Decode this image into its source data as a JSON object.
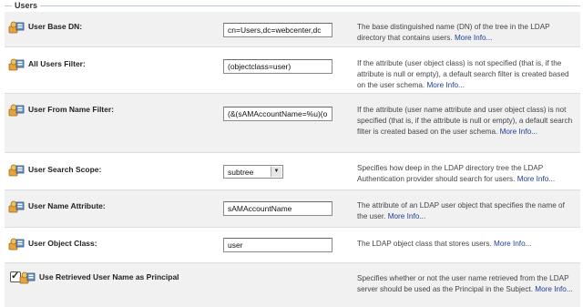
{
  "section": {
    "title": "Users"
  },
  "rows": [
    {
      "label": "User Base DN:",
      "value": "cn=Users,dc=webcenter,dc",
      "desc": "The base distinguished name (DN) of the tree in the LDAP directory that contains users.",
      "link": "More Info..."
    },
    {
      "label": "All Users Filter:",
      "value": "(objectclass=user)",
      "desc": "If the attribute (user object class) is not specified (that is, if the attribute is null or empty), a default search filter is created based on the user schema.",
      "link": "More Info..."
    },
    {
      "label": "User From Name Filter:",
      "value": "(&(sAMAccountName=%u)(o",
      "desc": "If the attribute (user name attribute and user object class) is not specified (that is, if the attribute is null or empty), a default search filter is created based on the user schema.",
      "link": "More Info..."
    },
    {
      "label": "User Search Scope:",
      "value": "subtree",
      "desc": "Specifies how deep in the LDAP directory tree the LDAP Authentication provider should search for users.",
      "link": "More Info..."
    },
    {
      "label": "User Name Attribute:",
      "value": "sAMAccountName",
      "desc": "The attribute of an LDAP user object that specifies the name of the user.",
      "link": "More Info..."
    },
    {
      "label": "User Object Class:",
      "value": "user",
      "desc": "The LDAP object class that stores users.",
      "link": "More Info..."
    },
    {
      "label": "Use Retrieved User Name as Principal",
      "checked": true,
      "desc": "Specifies whether or not the user name retrieved from the LDAP server should be used as the Principal in the Subject.",
      "link": "More Info..."
    }
  ],
  "icons": {
    "field_icon": "users-config-icon"
  },
  "colors": {
    "link": "#1f3f94",
    "shaded_row": "#f1f1f1",
    "divider": "#b9c9d8"
  }
}
